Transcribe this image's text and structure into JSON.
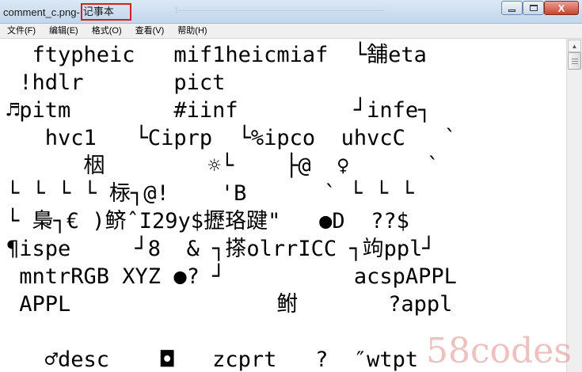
{
  "window": {
    "title_file": "comment_c.png",
    "title_sep": " - ",
    "title_app": "记事本",
    "title_ghost": "1——————————————————————————",
    "controls": {
      "close": "X"
    }
  },
  "menu": [
    "文件(F)",
    "编辑(E)",
    "格式(O)",
    "查看(V)",
    "帮助(H)"
  ],
  "content": [
    "  ftypheic   mif1heicmiaf  └舗eta",
    " !hdlr       pict",
    "♬pitm        #iinf         ┘infe┐",
    "   hvc1   └Ciprp  └%ipco  uhvcC   `",
    "      栶        ☼└    ├@  ♀      `",
    "└ └ └ └ 柡┐@!    'B      ` └ └ └",
    "└ 梟┐€ )鲚ˆI29y$攊珞踺\"   ●D  ??$",
    "¶ispe     ┘8  & ┐搽olrrICC ┐竘ppl┘",
    " mntrRGB XYZ ●? ┘          acspAPPL",
    " APPL                鲋       ?appl",
    "",
    "   ♂desc    ◘   zcprt   ?  ″wtpt"
  ],
  "watermark": "58codes"
}
